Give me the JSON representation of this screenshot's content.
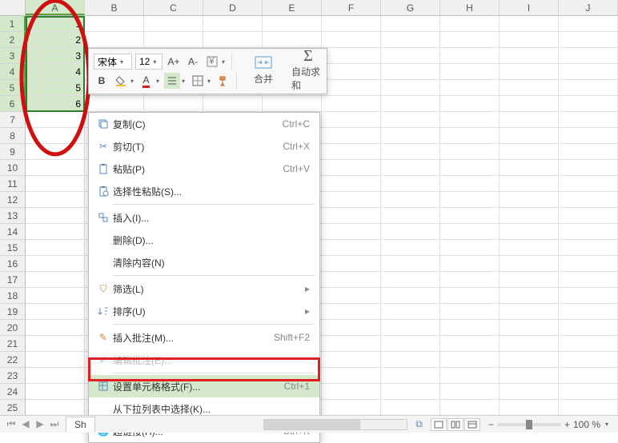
{
  "columns": [
    "A",
    "B",
    "C",
    "D",
    "E",
    "F",
    "G",
    "H",
    "I",
    "J"
  ],
  "rows": [
    1,
    2,
    3,
    4,
    5,
    6,
    7,
    8,
    9,
    10,
    11,
    12,
    13,
    14,
    15,
    16,
    17,
    18,
    19,
    20,
    21,
    22,
    23,
    24,
    25
  ],
  "selected_col": "A",
  "selected_rows": [
    1,
    2,
    3,
    4,
    5,
    6
  ],
  "cell_values": {
    "A1": "1",
    "A2": "2",
    "A3": "3",
    "A4": "4",
    "A5": "5",
    "A6": "6"
  },
  "mini_toolbar": {
    "font_name": "宋体",
    "font_size": "12",
    "merge_label": "合并",
    "autosum_label": "自动求和"
  },
  "context_menu": {
    "copy": {
      "label": "复制(C)",
      "shortcut": "Ctrl+C"
    },
    "cut": {
      "label": "剪切(T)",
      "shortcut": "Ctrl+X"
    },
    "paste": {
      "label": "粘贴(P)",
      "shortcut": "Ctrl+V"
    },
    "paste_special": {
      "label": "选择性粘贴(S)..."
    },
    "insert": {
      "label": "插入(I)..."
    },
    "delete": {
      "label": "删除(D)..."
    },
    "clear": {
      "label": "清除内容(N)"
    },
    "filter": {
      "label": "筛选(L)"
    },
    "sort": {
      "label": "排序(U)"
    },
    "insert_comment": {
      "label": "插入批注(M)...",
      "shortcut": "Shift+F2"
    },
    "edit_comment": {
      "label": "编辑批注(E)..."
    },
    "format_cells": {
      "label": "设置单元格格式(F)...",
      "shortcut": "Ctrl+1"
    },
    "dropdown_select": {
      "label": "从下拉列表中选择(K)..."
    },
    "hyperlink": {
      "label": "超链接(H)...",
      "shortcut": "Ctrl+K"
    }
  },
  "sheet_tab": "Sh",
  "status": {
    "zoom": "100 %",
    "book_icon": true
  }
}
